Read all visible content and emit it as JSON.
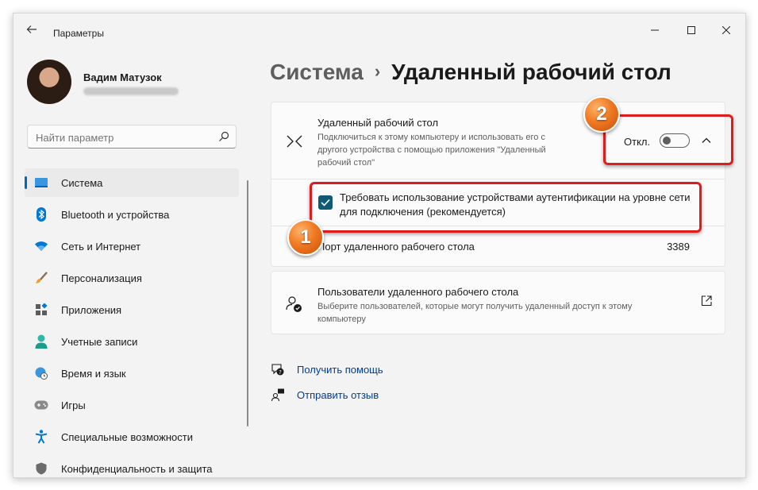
{
  "window": {
    "title": "Параметры"
  },
  "user": {
    "name": "Вадим Матузок"
  },
  "search": {
    "placeholder": "Найти параметр"
  },
  "sidebar": {
    "items": [
      {
        "label": "Система",
        "icon": "system-icon",
        "active": true
      },
      {
        "label": "Bluetooth и устройства",
        "icon": "bluetooth-icon"
      },
      {
        "label": "Сеть и Интернет",
        "icon": "wifi-icon"
      },
      {
        "label": "Персонализация",
        "icon": "brush-icon"
      },
      {
        "label": "Приложения",
        "icon": "apps-icon"
      },
      {
        "label": "Учетные записи",
        "icon": "account-icon"
      },
      {
        "label": "Время и язык",
        "icon": "globe-clock-icon"
      },
      {
        "label": "Игры",
        "icon": "gamepad-icon"
      },
      {
        "label": "Специальные возможности",
        "icon": "accessibility-icon"
      },
      {
        "label": "Конфиденциальность и защита",
        "icon": "shield-icon"
      }
    ]
  },
  "breadcrumb": {
    "parent": "Система",
    "separator": "›",
    "current": "Удаленный рабочий стол"
  },
  "remote_desktop": {
    "title": "Удаленный рабочий стол",
    "description": "Подключиться к этому компьютеру и использовать его с другого устройства с помощью приложения \"Удаленный рабочий стол\"",
    "toggle_label": "Откл.",
    "toggle_on": false,
    "nla_label": "Требовать использование устройствами аутентификации на уровне сети для подключения (рекомендуется)",
    "nla_checked": true,
    "port_label": "Порт удаленного рабочего стола",
    "port_value": "3389"
  },
  "remote_users": {
    "title": "Пользователи удаленного рабочего стола",
    "description": "Выберите пользователей, которые могут получить удаленный доступ к этому компьютеру"
  },
  "links": {
    "help": "Получить помощь",
    "feedback": "Отправить отзыв"
  },
  "annotations": {
    "badge1": "1",
    "badge2": "2",
    "highlight_color": "#e01b1b"
  },
  "colors": {
    "accent": "#0067c0",
    "link": "#003e92",
    "checkbox": "#0f5b75"
  }
}
